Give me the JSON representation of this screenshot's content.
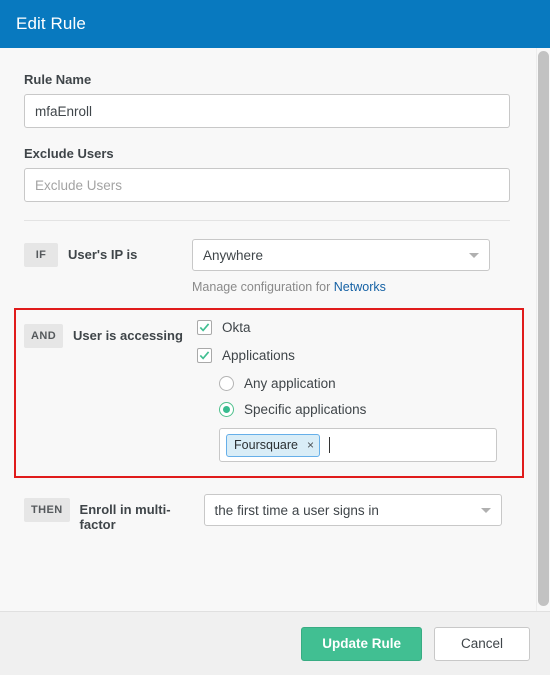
{
  "header": {
    "title": "Edit Rule"
  },
  "form": {
    "rule_name": {
      "label": "Rule Name",
      "value": "mfaEnroll"
    },
    "exclude_users": {
      "label": "Exclude Users",
      "value": "",
      "placeholder": "Exclude Users"
    }
  },
  "conditions": {
    "if": {
      "badge": "IF",
      "label": "User's IP is",
      "select_value": "Anywhere",
      "helper_prefix": "Manage configuration for ",
      "helper_link": "Networks"
    },
    "and": {
      "badge": "AND",
      "label": "User is accessing",
      "checkboxes": [
        {
          "label": "Okta",
          "checked": true
        },
        {
          "label": "Applications",
          "checked": true
        }
      ],
      "radios": [
        {
          "label": "Any application",
          "checked": false
        },
        {
          "label": "Specific applications",
          "checked": true
        }
      ],
      "tags": [
        {
          "label": "Foursquare",
          "remove": "×"
        }
      ]
    },
    "then": {
      "badge": "THEN",
      "label": "Enroll in multi-factor",
      "select_value": "the first time a user signs in"
    }
  },
  "footer": {
    "primary_label": "Update Rule",
    "cancel_label": "Cancel"
  },
  "colors": {
    "header_blue": "#0879bf",
    "primary_green": "#41bf92",
    "highlight_red": "#e01b1b",
    "link_blue": "#1662a5",
    "tag_blue_bg": "#d9edf7",
    "tag_blue_border": "#66afe9"
  }
}
